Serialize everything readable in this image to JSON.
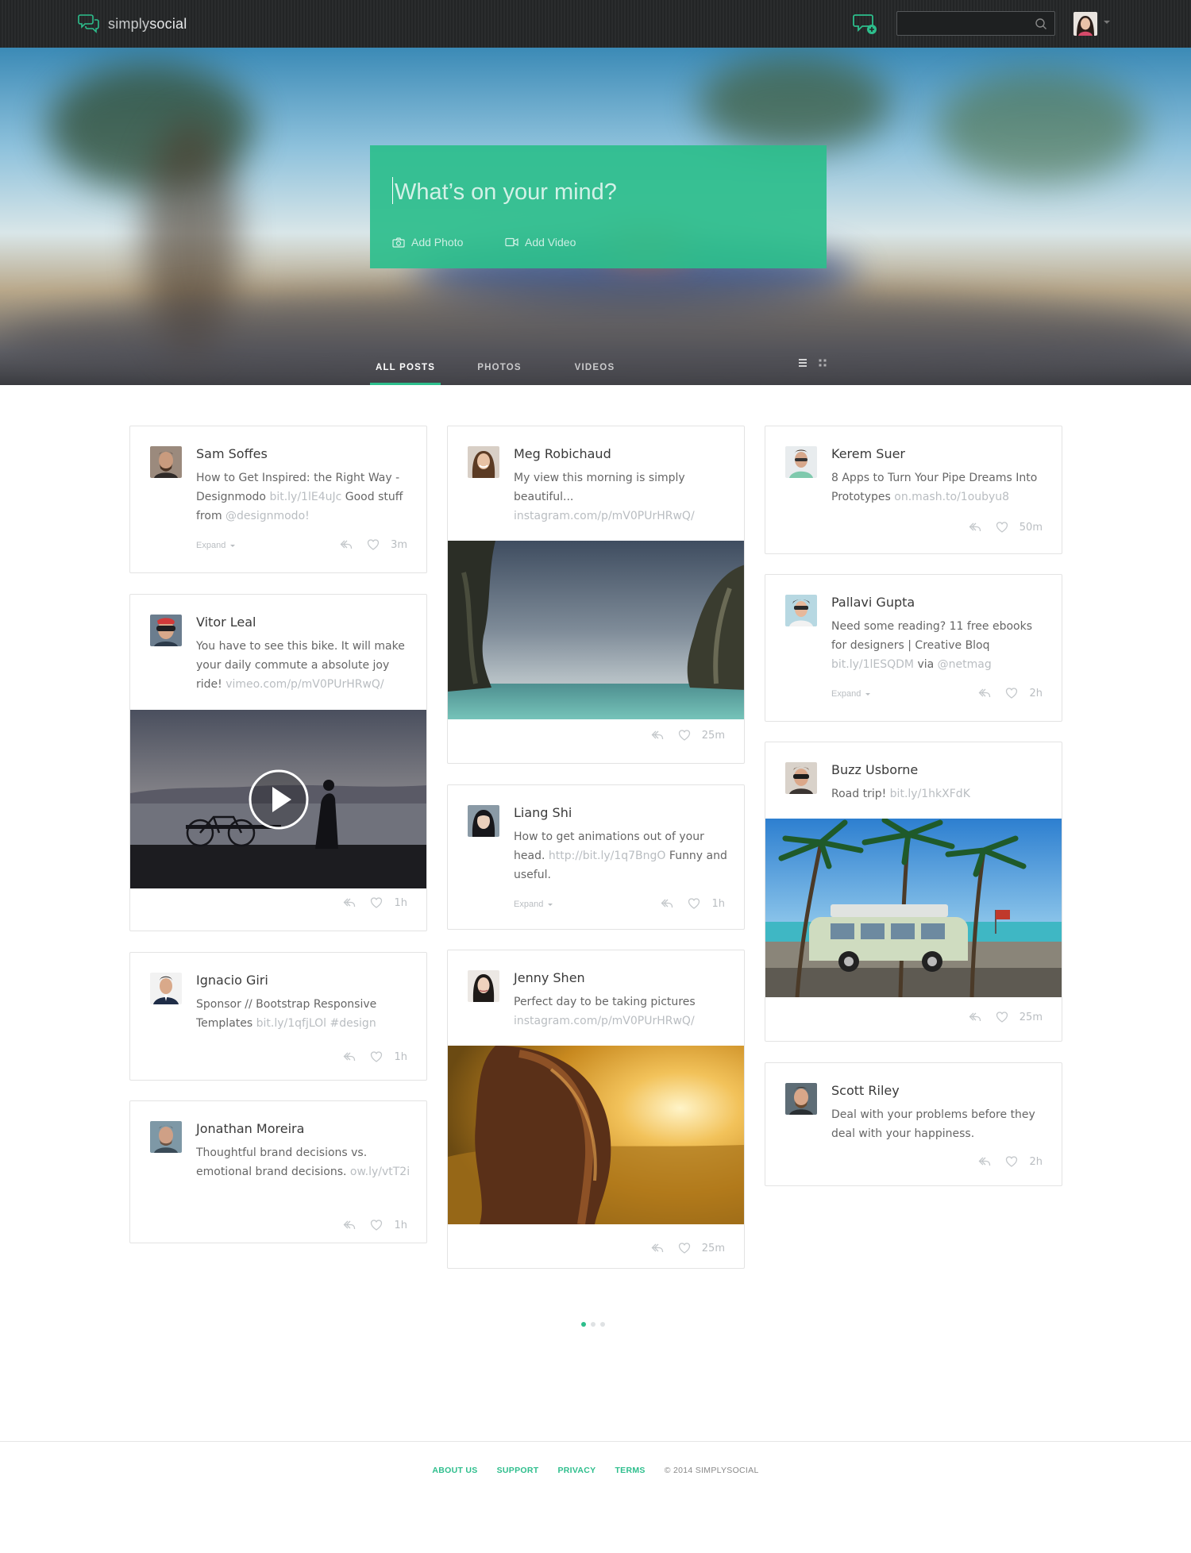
{
  "app": {
    "logo_light": "simply",
    "logo_bold": "social",
    "accent": "#2dbe8c"
  },
  "search": {
    "placeholder": "",
    "value": ""
  },
  "composer": {
    "placeholder": "What’s on your mind?",
    "add_photo": "Add Photo",
    "add_video": "Add Video"
  },
  "tabs": [
    {
      "label": "ALL POSTS",
      "active": true
    },
    {
      "label": "PHOTOS",
      "active": false
    },
    {
      "label": "VIDEOS",
      "active": false
    }
  ],
  "posts": {
    "sam": {
      "name": "Sam Soffes",
      "t1": "How to Get Inspired: the Right Way - Designmodo ",
      "link1": "bit.ly/1lE4uJc",
      "t2": " Good stuff from ",
      "link2": "@designmodo!",
      "expand": "Expand",
      "time": "3m"
    },
    "vitor": {
      "name": "Vitor Leal",
      "t1": "You have to see this bike. It will make your daily commute a absolute joy ride! ",
      "link1": "vimeo.com/p/mV0PUrHRwQ/",
      "time": "1h"
    },
    "ignacio": {
      "name": "Ignacio Giri",
      "t1": "Sponsor // Bootstrap Responsive Templates ",
      "link1": "bit.ly/1qfjLOl #design",
      "time": "1h"
    },
    "jonathan": {
      "name": "Jonathan Moreira",
      "t1": "Thoughtful brand decisions vs. emotional brand decisions. ",
      "link1": "ow.ly/vtT2i",
      "time": "1h"
    },
    "meg": {
      "name": "Meg Robichaud",
      "t1": "My view this morning is simply beautiful... ",
      "link1": "instagram.com/p/mV0PUrHRwQ/",
      "time": "25m"
    },
    "liang": {
      "name": "Liang Shi",
      "t1": "How to get animations out of your head. ",
      "link1": "http://bit.ly/1q7BngO",
      "t2": "  Funny and useful.",
      "expand": "Expand",
      "time": "1h"
    },
    "jenny": {
      "name": "Jenny Shen",
      "t1": "Perfect day to be taking pictures ",
      "link1": "instagram.com/p/mV0PUrHRwQ/",
      "time": "25m"
    },
    "kerem": {
      "name": "Kerem Suer",
      "t1": "8 Apps to Turn Your Pipe Dreams Into Prototypes ",
      "link1": "on.mash.to/1oubyu8",
      "time": "50m"
    },
    "pallavi": {
      "name": "Pallavi Gupta",
      "t1": "Need some reading? 11 free ebooks for designers | Creative Bloq ",
      "link1": "bit.ly/1lESQDM",
      "t2": " via ",
      "link2": "@netmag",
      "expand": "Expand",
      "time": "2h"
    },
    "buzz": {
      "name": "Buzz Usborne",
      "t1": "Road trip!  ",
      "link1": "bit.ly/1hkXFdK",
      "time": "25m"
    },
    "scott": {
      "name": "Scott Riley",
      "t1": "Deal with your problems before they deal with your happiness.",
      "time": "2h"
    }
  },
  "pagination": {
    "pages": 3,
    "current": 1
  },
  "footer": {
    "about": "ABOUT US",
    "support": "SUPPORT",
    "privacy": "PRIVACY",
    "terms": "TERMS",
    "copyright": "© 2014 SIMPLYSOCIAL"
  }
}
